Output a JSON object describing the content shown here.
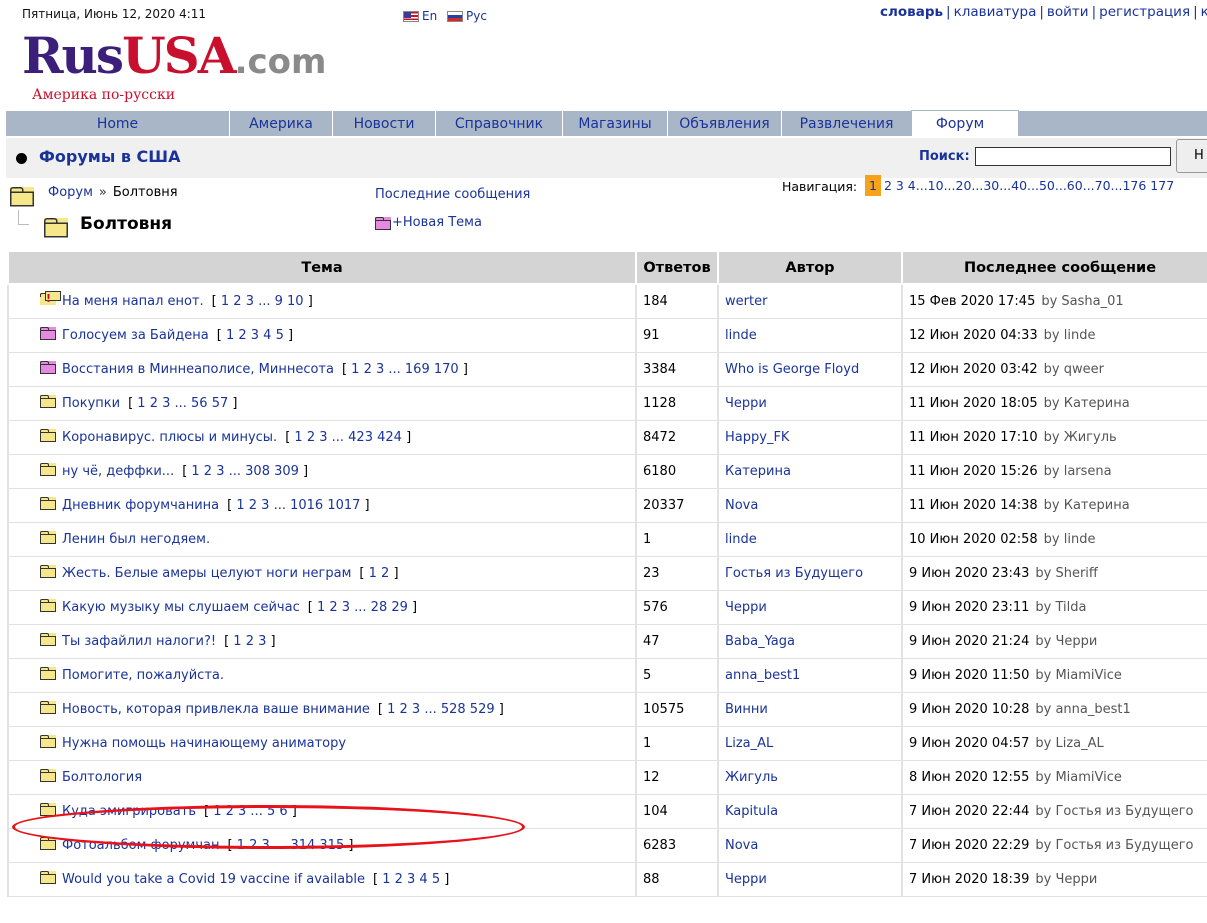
{
  "header": {
    "date": "Пятница, Июнь 12, 2020 4:11",
    "lang_en": "En",
    "lang_ru": "Рус",
    "top_links": [
      "словарь",
      "клавиатура",
      "войти",
      "регистрация",
      "к"
    ],
    "logo_rus": "Rus",
    "logo_usa": "USA",
    "logo_com": ".com",
    "tagline": "Америка по-русски"
  },
  "nav": {
    "tabs": [
      "Home",
      "Америка",
      "Новости",
      "Справочник",
      "Магазины",
      "Объявления",
      "Развлечения",
      "Форум"
    ],
    "active": "Форум"
  },
  "forum": {
    "title": "Форумы в США",
    "search_label": "Поиск:",
    "search_value": "",
    "search_button": "Н",
    "breadcrumb_root": "Форум",
    "breadcrumb_sep": "»",
    "breadcrumb_current": "Болтовня",
    "last_posts": "Последние сообщения",
    "nav_label": "Навигация:",
    "pages_current": "1",
    "pages_rest": "2 3 4...10...20...30...40...50...60...70...176 177",
    "subforum": "Болтовня",
    "new_topic": "+Новая Тема"
  },
  "table": {
    "headers": [
      "Тема",
      "Ответов",
      "Автор",
      "Последнее сообщение"
    ],
    "rows": [
      {
        "icon": "folder-important-icon",
        "title": "На меня напал енот.",
        "pages": "1 2 3 ... 9 10",
        "replies": "184",
        "author": "werter",
        "last": "15 Фев 2020 17:45",
        "by": "by Sasha_01"
      },
      {
        "icon": "folder-pink-icon",
        "title": "Голосуем за Байдена",
        "pages": "1 2 3 4 5",
        "replies": "91",
        "author": "linde",
        "last": "12 Июн 2020 04:33",
        "by": "by linde"
      },
      {
        "icon": "folder-pink-icon",
        "title": "Восстания в Миннеаполисе, Миннесота",
        "pages": "1 2 3 ... 169 170",
        "replies": "3384",
        "author": "Who is George Floyd",
        "last": "12 Июн 2020 03:42",
        "by": "by qweer"
      },
      {
        "icon": "folder-icon",
        "title": "Покупки",
        "pages": "1 2 3 ... 56 57",
        "replies": "1128",
        "author": "Черри",
        "last": "11 Июн 2020 18:05",
        "by": "by Катерина"
      },
      {
        "icon": "folder-icon",
        "title": "Коронавирус. плюсы и минусы.",
        "pages": "1 2 3 ... 423 424",
        "replies": "8472",
        "author": "Happy_FK",
        "last": "11 Июн 2020 17:10",
        "by": "by Жигуль"
      },
      {
        "icon": "folder-icon",
        "title": "ну чё, деффки...",
        "pages": "1 2 3 ... 308 309",
        "replies": "6180",
        "author": "Катерина",
        "last": "11 Июн 2020 15:26",
        "by": "by larsena"
      },
      {
        "icon": "folder-icon",
        "title": "Дневник форумчанина",
        "pages": "1 2 3 ... 1016 1017",
        "replies": "20337",
        "author": "Nova",
        "last": "11 Июн 2020 14:38",
        "by": "by Катерина"
      },
      {
        "icon": "folder-icon",
        "title": "Ленин был негодяем.",
        "pages": "",
        "replies": "1",
        "author": "linde",
        "last": "10 Июн 2020 02:58",
        "by": "by linde"
      },
      {
        "icon": "folder-icon",
        "title": "Жесть. Белые амеры целуют ноги неграм",
        "pages": "1 2",
        "replies": "23",
        "author": "Гостья из Будущего",
        "last": "9 Июн 2020 23:43",
        "by": "by Sheriff"
      },
      {
        "icon": "folder-icon",
        "title": "Какую музыку мы слушаем сейчас",
        "pages": "1 2 3 ... 28 29",
        "replies": "576",
        "author": "Черри",
        "last": "9 Июн 2020 23:11",
        "by": "by Tilda"
      },
      {
        "icon": "folder-icon",
        "title": "Ты зафайлил налоги?!",
        "pages": "1 2 3",
        "replies": "47",
        "author": "Baba_Yaga",
        "last": "9 Июн 2020 21:24",
        "by": "by Черри"
      },
      {
        "icon": "folder-icon",
        "title": "Помогите, пожалуйста.",
        "pages": "",
        "replies": "5",
        "author": "anna_best1",
        "last": "9 Июн 2020 11:50",
        "by": "by MiamiVice"
      },
      {
        "icon": "folder-icon",
        "title": "Новость, которая привлекла ваше внимание",
        "pages": "1 2 3 ... 528 529",
        "replies": "10575",
        "author": "Винни",
        "last": "9 Июн 2020 10:28",
        "by": "by anna_best1"
      },
      {
        "icon": "folder-icon",
        "title": "Нужна помощь начинающему аниматору",
        "pages": "",
        "replies": "1",
        "author": "Liza_AL",
        "last": "9 Июн 2020 04:57",
        "by": "by Liza_AL"
      },
      {
        "icon": "folder-icon",
        "title": "Болтология",
        "pages": "",
        "replies": "12",
        "author": "Жигуль",
        "last": "8 Июн 2020 12:55",
        "by": "by MiamiVice"
      },
      {
        "icon": "folder-icon",
        "title": "Куда эмигрировать",
        "pages": "1 2 3 ... 5 6",
        "replies": "104",
        "author": "Kapitula",
        "last": "7 Июн 2020 22:44",
        "by": "by Гостья из Будущего"
      },
      {
        "icon": "folder-icon",
        "title": "Фотоальбом форумчан",
        "pages": "1 2 3 ... 314 315",
        "replies": "6283",
        "author": "Nova",
        "last": "7 Июн 2020 22:29",
        "by": "by Гостья из Будущего"
      },
      {
        "icon": "folder-icon",
        "title": "Would you take a Covid 19 vaccine if available",
        "pages": "1 2 3 4 5",
        "replies": "88",
        "author": "Черри",
        "last": "7 Июн 2020 18:39",
        "by": "by Черри"
      }
    ]
  },
  "colors": {
    "link": "#1a3399",
    "nav_bg": "#a9b6c7",
    "page_highlight": "#f7a21b",
    "annotation": "#e8121b"
  }
}
